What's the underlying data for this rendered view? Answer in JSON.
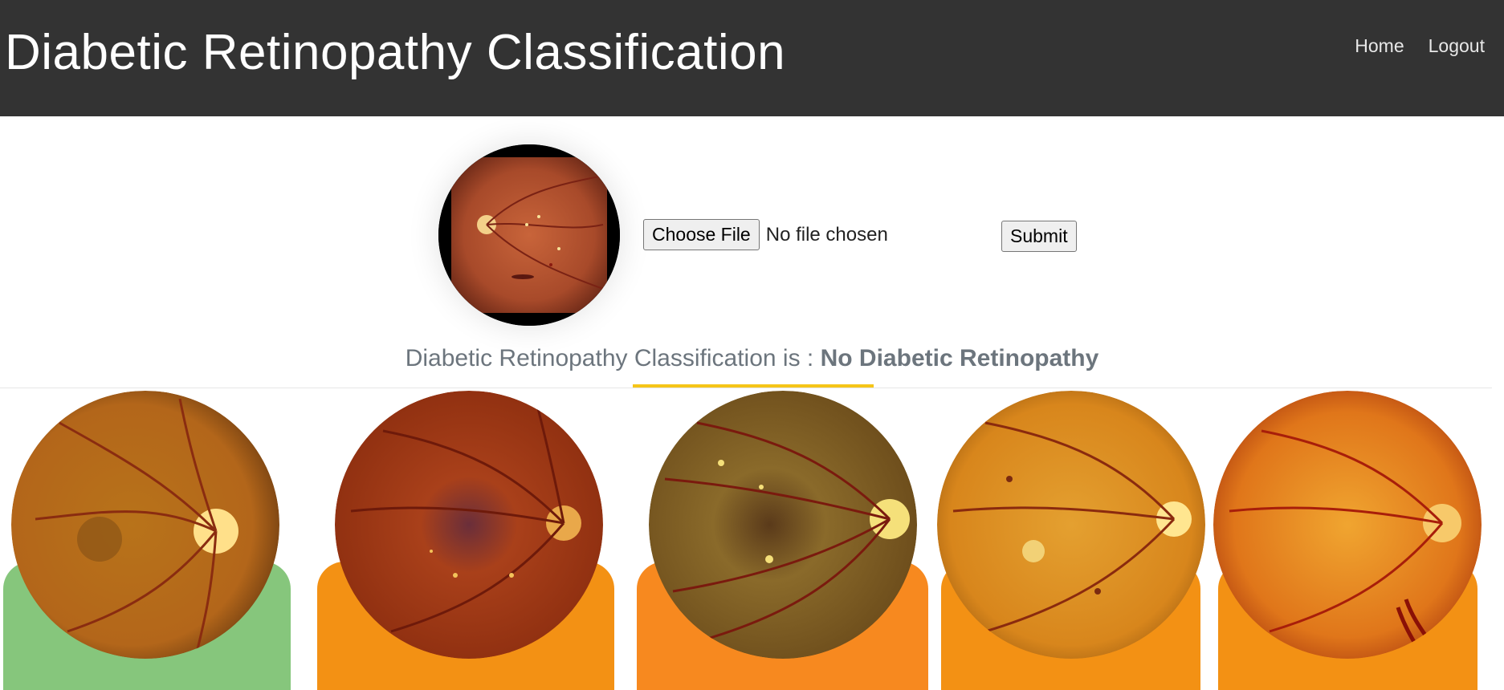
{
  "header": {
    "title": "Diabetic Retinopathy Classification",
    "nav": [
      "Home",
      "Logout"
    ]
  },
  "upload": {
    "choose_label": "Choose File",
    "file_status": "No file chosen",
    "submit_label": "Submit"
  },
  "result": {
    "prefix": "Diabetic Retinopathy Classification is :",
    "value": "No Diabetic Retinopathy"
  },
  "colors": {
    "header_bg": "#333333",
    "accent": "#f5c518",
    "card_green": "#86c67c",
    "card_orange": "#f39114"
  },
  "gallery": [
    {
      "icon": "fundus-image",
      "card_color": "#86c67c"
    },
    {
      "icon": "fundus-image",
      "card_color": "#f39114"
    },
    {
      "icon": "fundus-image",
      "card_color": "#f7891f"
    },
    {
      "icon": "fundus-image",
      "card_color": "#f39114"
    },
    {
      "icon": "fundus-image",
      "card_color": "#f39114"
    }
  ]
}
